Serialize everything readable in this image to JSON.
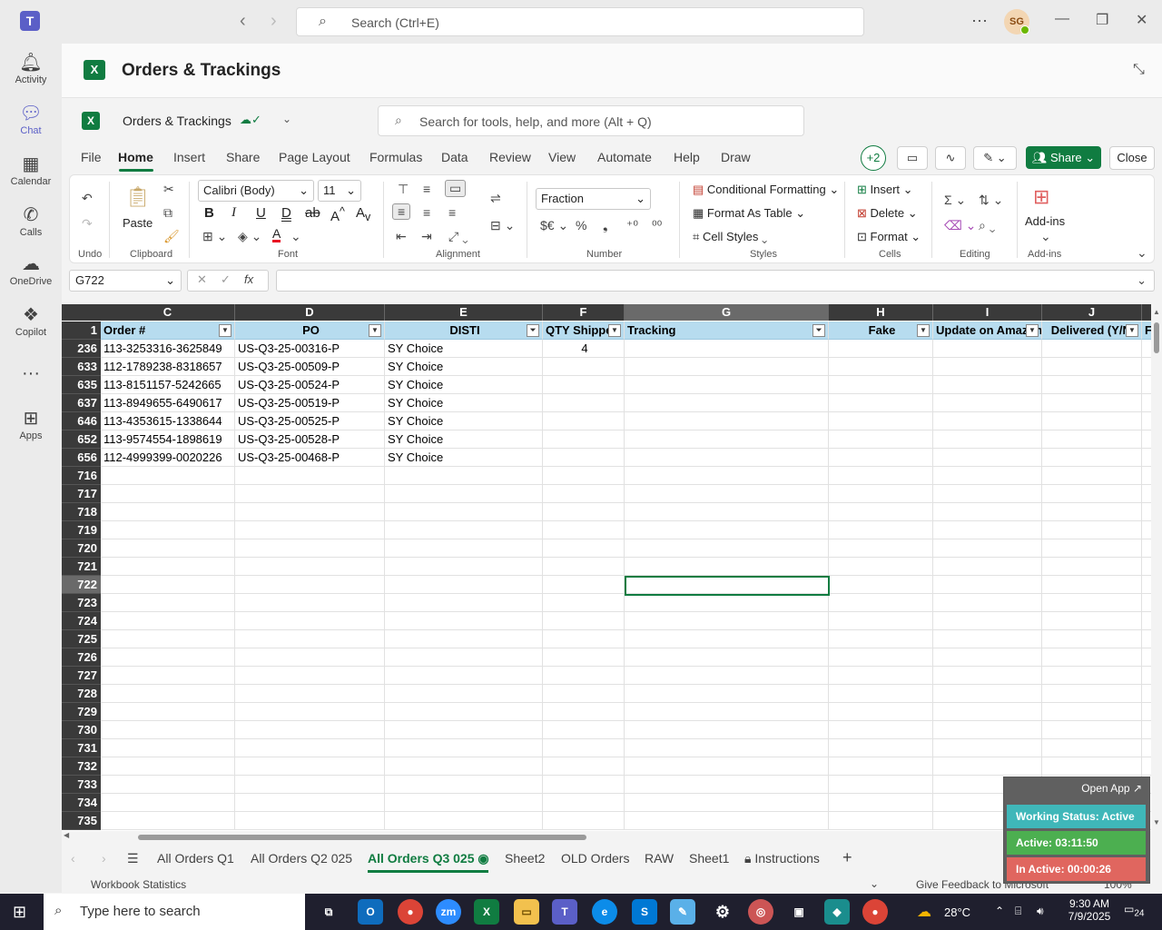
{
  "teams": {
    "search_placeholder": "Search (Ctrl+E)",
    "avatar_initials": "SG",
    "rail": [
      {
        "label": "Activity",
        "icon": "bell-icon"
      },
      {
        "label": "Chat",
        "icon": "chat-icon"
      },
      {
        "label": "Calendar",
        "icon": "calendar-icon"
      },
      {
        "label": "Calls",
        "icon": "phone-icon"
      },
      {
        "label": "OneDrive",
        "icon": "cloud-icon"
      },
      {
        "label": "Copilot",
        "icon": "copilot-icon"
      },
      {
        "label": "Apps",
        "icon": "apps-icon"
      }
    ]
  },
  "app": {
    "title": "Orders & Trackings"
  },
  "excel": {
    "filename": "Orders & Trackings",
    "tools_search": "Search for tools, help, and more (Alt + Q)",
    "menu": [
      "File",
      "Home",
      "Insert",
      "Share",
      "Page Layout",
      "Formulas",
      "Data",
      "Review",
      "View",
      "Automate",
      "Help",
      "Draw"
    ],
    "collaborators": "+2",
    "share_label": "Share",
    "close_label": "Close",
    "ribbon": {
      "undo_group": "Undo",
      "clipboard_group": "Clipboard",
      "paste_label": "Paste",
      "font_group": "Font",
      "font_name": "Calibri (Body)",
      "font_size": "11",
      "alignment_group": "Alignment",
      "number_group": "Number",
      "number_format": "Fraction",
      "styles_group": "Styles",
      "conditional_formatting": "Conditional Formatting",
      "format_as_table": "Format As Table",
      "cell_styles": "Cell Styles",
      "cells_group": "Cells",
      "insert": "Insert",
      "delete": "Delete",
      "format": "Format",
      "editing_group": "Editing",
      "addins_label": "Add-ins",
      "addins_group": "Add-ins"
    },
    "name_box": "G722",
    "columns": [
      {
        "letter": "C",
        "header": "Order #"
      },
      {
        "letter": "D",
        "header": "PO"
      },
      {
        "letter": "E",
        "header": "DISTI"
      },
      {
        "letter": "F",
        "header": "QTY Shipped"
      },
      {
        "letter": "G",
        "header": "Tracking"
      },
      {
        "letter": "H",
        "header": "Fake"
      },
      {
        "letter": "I",
        "header": "Update on Amazon"
      },
      {
        "letter": "J",
        "header": "Delivered (Y/N)"
      }
    ],
    "header_row_number": "1",
    "data_rows": [
      {
        "row": "236",
        "order": "113-3253316-3625849",
        "po": "US-Q3-25-00316-P",
        "disti": "SY Choice",
        "qty": "4"
      },
      {
        "row": "633",
        "order": "112-1789238-8318657",
        "po": "US-Q3-25-00509-P",
        "disti": "SY Choice",
        "qty": ""
      },
      {
        "row": "635",
        "order": "113-8151157-5242665",
        "po": "US-Q3-25-00524-P",
        "disti": "SY Choice",
        "qty": ""
      },
      {
        "row": "637",
        "order": "113-8949655-6490617",
        "po": "US-Q3-25-00519-P",
        "disti": "SY Choice",
        "qty": ""
      },
      {
        "row": "646",
        "order": "113-4353615-1338644",
        "po": "US-Q3-25-00525-P",
        "disti": "SY Choice",
        "qty": ""
      },
      {
        "row": "652",
        "order": "113-9574554-1898619",
        "po": "US-Q3-25-00528-P",
        "disti": "SY Choice",
        "qty": ""
      },
      {
        "row": "656",
        "order": "112-4999399-0020226",
        "po": "US-Q3-25-00468-P",
        "disti": "SY Choice",
        "qty": ""
      }
    ],
    "empty_rows": [
      "716",
      "717",
      "718",
      "719",
      "720",
      "721",
      "722",
      "723",
      "724",
      "725",
      "726",
      "727",
      "728",
      "729",
      "730",
      "731",
      "732",
      "733",
      "734",
      "735"
    ],
    "selected_row": "722",
    "sheet_tabs": [
      "All Orders Q1",
      "All Orders Q2 025",
      "All Orders Q3 025",
      "Sheet2",
      "OLD Orders",
      "RAW",
      "Sheet1",
      "Instructions"
    ],
    "active_sheet": "All Orders Q3 025",
    "status_left": "Workbook Statistics",
    "status_feedback": "Give Feedback to Microsoft",
    "zoom": "100%"
  },
  "widget": {
    "open_app": "Open App",
    "working_status": "Working Status: Active",
    "active": "Active: 03:11:50",
    "inactive": "In Active: 00:00:26",
    "colors": {
      "status": "#3fb7b9",
      "active": "#4caf50",
      "inactive": "#e0665f"
    }
  },
  "taskbar": {
    "search_placeholder": "Type here to search",
    "temperature": "28°C",
    "time": "9:30 AM",
    "date": "7/9/2025",
    "notifications": "24"
  }
}
